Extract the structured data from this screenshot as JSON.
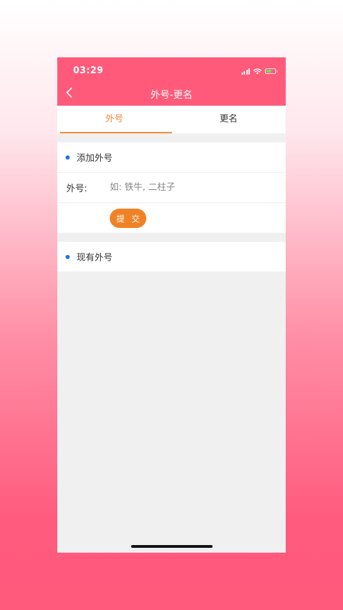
{
  "status_bar": {
    "time": "03:29",
    "battery_level_percent": 60,
    "battery_color": "#7ed957"
  },
  "header": {
    "title": "外号-更名",
    "back_icon": "chevron-left-icon",
    "background": "#ff5a7a"
  },
  "tabs": [
    {
      "label": "外号",
      "active": true
    },
    {
      "label": "更名",
      "active": false
    }
  ],
  "add_section": {
    "heading": "添加外号",
    "field_label": "外号:",
    "field_value": "",
    "field_placeholder": "如: 铁牛, 二柱子",
    "submit_label": "提 交"
  },
  "existing_section": {
    "heading": "现有外号"
  },
  "colors": {
    "accent": "#f08226",
    "bullet": "#1a74e8",
    "page_bg": "#f0f0f0"
  }
}
